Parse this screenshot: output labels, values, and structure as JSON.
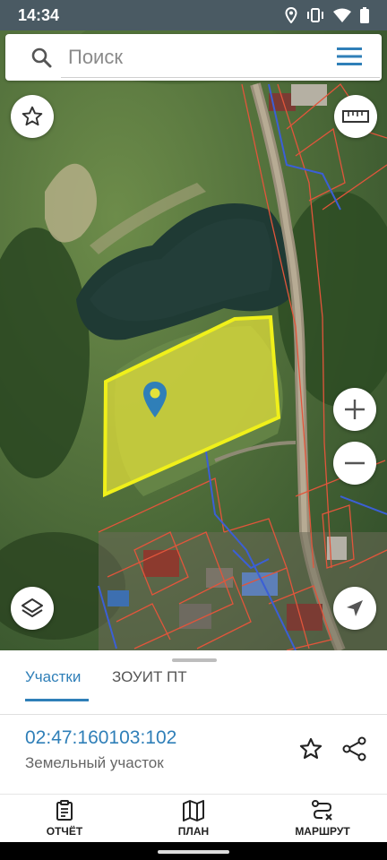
{
  "status_bar": {
    "time": "14:34"
  },
  "search": {
    "placeholder": "Поиск"
  },
  "tabs": [
    {
      "label": "Участки",
      "active": true
    },
    {
      "label": "ЗОУИТ ПТ",
      "active": false
    }
  ],
  "parcel": {
    "number": "02:47:160103:102",
    "type": "Земельный участок"
  },
  "bottom_nav": [
    {
      "label": "ОТЧЁТ",
      "icon": "clipboard-icon"
    },
    {
      "label": "ПЛАН",
      "icon": "map-icon"
    },
    {
      "label": "МАРШРУТ",
      "icon": "route-icon"
    }
  ],
  "colors": {
    "accent": "#2f7fb8",
    "parcel_fill": "#e4e23a",
    "parcel_border": "#f0f01a",
    "cadastral_lines": "#e2553b",
    "boundary_lines": "#3b5fd6",
    "status_bar": "#4a5a63"
  }
}
